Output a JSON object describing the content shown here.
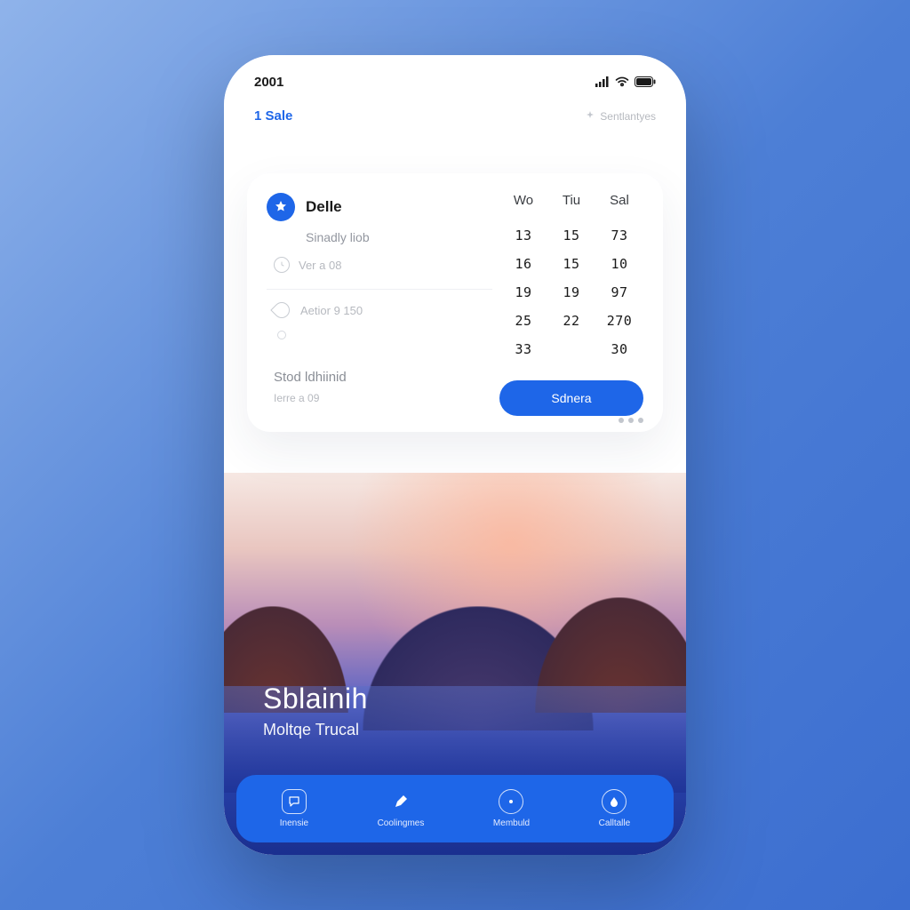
{
  "statusbar": {
    "time": "2001"
  },
  "header": {
    "left_label": "1 Sale",
    "right_label": "Sentlantyes"
  },
  "card": {
    "title": "Delle",
    "subtitle": "Sinadly liob",
    "ver_label": "Ver a 08",
    "aetior_label": "Aetior 9 150",
    "stod_title": "Stod ldhiinid",
    "stod_sub": "Ierre a 09",
    "button_label": "Sdnera"
  },
  "calendar": {
    "headers": [
      "Wo",
      "Tiu",
      "Sal"
    ],
    "rows": [
      [
        "13",
        "15",
        "73"
      ],
      [
        "16",
        "15",
        "10"
      ],
      [
        "19",
        "19",
        "97"
      ],
      [
        "25",
        "22",
        "270"
      ],
      [
        "33",
        "",
        "30"
      ]
    ]
  },
  "scenic": {
    "title": "Sblainih",
    "subtitle": "Moltqe Trucal"
  },
  "nav": {
    "items": [
      {
        "label": "Inensie"
      },
      {
        "label": "Coolingmes"
      },
      {
        "label": "Membuld"
      },
      {
        "label": "Calltalle"
      }
    ]
  }
}
